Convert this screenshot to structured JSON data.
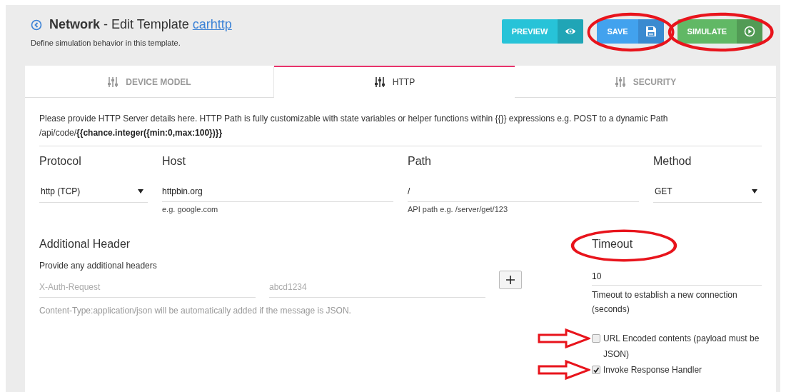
{
  "header": {
    "title": "**Network** - Edit Template ",
    "link": "carhttp",
    "subtitle": "Define simulation behavior in this template."
  },
  "buttons": [
    {
      "label": "PREVIEW",
      "kind": "preview",
      "circled": false
    },
    {
      "label": "SAVE",
      "kind": "save",
      "circled": true
    },
    {
      "label": "SIMULATE",
      "kind": "simulate",
      "circled": true
    }
  ],
  "tabs": [
    {
      "label": "DEVICE MODEL",
      "selected": false
    },
    {
      "label": "HTTP",
      "selected": true
    },
    {
      "label": "SECURITY",
      "selected": false
    }
  ],
  "intro": "Please provide HTTP Server details here. HTTP Path is fully customizable with state variables or helper functions within {{}} expressions e.g. POST to a dynamic Path /api/code/**{{chance.integer({min:0,max:100})}}**",
  "fields": [
    {
      "label": "Protocol",
      "kind": "select",
      "value": "http (TCP)"
    },
    {
      "label": "Host",
      "kind": "text",
      "value": "httpbin.org",
      "hint": "e.g. google.com"
    },
    {
      "label": "Path",
      "kind": "text",
      "value": "/",
      "hint": "API path e.g. /server/get/123"
    },
    {
      "label": "Method",
      "kind": "select",
      "value": "GET"
    }
  ],
  "headers": {
    "title": "Additional Header",
    "description": "Provide any additional headers",
    "name_placeholder": "X-Auth-Request",
    "value_placeholder": "abcd1234",
    "note": "Content-Type:application/json will be automatically added if the message is JSON."
  },
  "timeout": {
    "label": "Timeout",
    "circled": true,
    "value": "10",
    "hint": "Timeout to establish a new connection (seconds)"
  },
  "options": [
    {
      "label": "URL Encoded contents (payload must be JSON)",
      "checked": false,
      "arrowed": true
    },
    {
      "label": "Invoke Response Handler",
      "checked": true,
      "arrowed": true
    }
  ]
}
